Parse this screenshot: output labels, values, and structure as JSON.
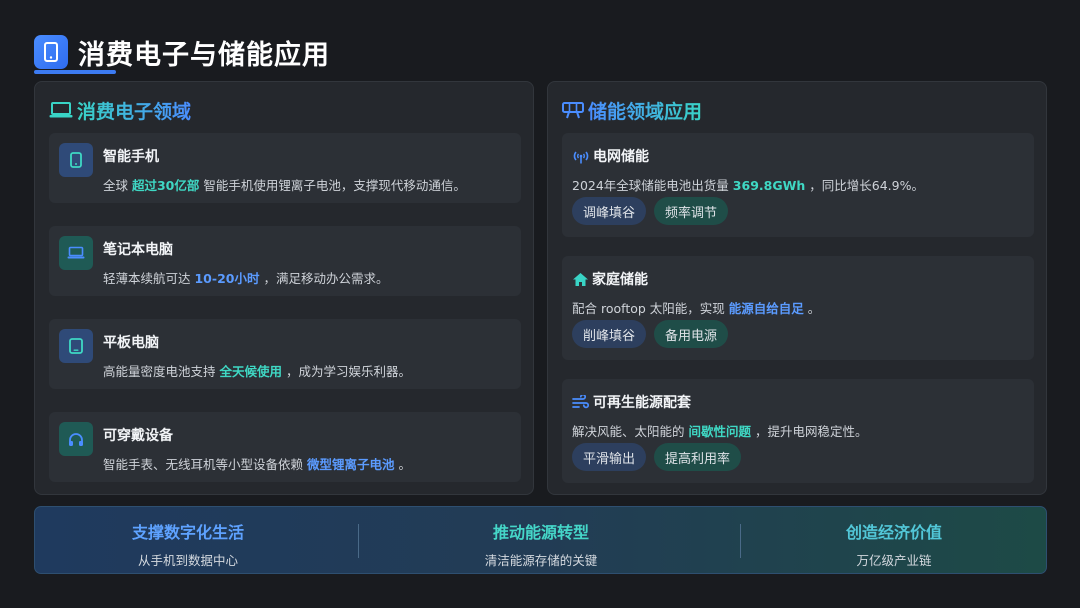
{
  "header": {
    "title": "消费电子与储能应用",
    "icon": "phone-icon"
  },
  "left_panel": {
    "title": "消费电子领域",
    "icon": "laptop-icon",
    "items": [
      {
        "name": "智能手机",
        "icon": "phone-icon",
        "pre": "全球 ",
        "highlight": "超过30亿部",
        "post": " 智能手机使用锂离子电池，支撑现代移动通信。"
      },
      {
        "name": "笔记本电脑",
        "icon": "laptop-icon",
        "pre": "轻薄本续航可达 ",
        "highlight": "10-20小时",
        "post": " ，满足移动办公需求。"
      },
      {
        "name": "平板电脑",
        "icon": "tablet-icon",
        "pre": "高能量密度电池支持 ",
        "highlight": "全天候使用",
        "post": " ，成为学习娱乐利器。"
      },
      {
        "name": "可穿戴设备",
        "icon": "headphones-icon",
        "pre": "智能手表、无线耳机等小型设备依赖 ",
        "highlight": "微型锂离子电池",
        "post": " 。"
      }
    ]
  },
  "right_panel": {
    "title": "储能领域应用",
    "icon": "grid-tower-icon",
    "items": [
      {
        "name": "电网储能",
        "icon": "broadcast-tower-icon",
        "pre": "2024年全球储能电池出货量 ",
        "highlight": "369.8GWh",
        "post": " ，同比增长64.9%。",
        "tags": [
          "调峰填谷",
          "频率调节"
        ]
      },
      {
        "name": "家庭储能",
        "icon": "home-icon",
        "pre": "配合 rooftop 太阳能，实现 ",
        "highlight": "能源自给自足",
        "post": " 。",
        "tags": [
          "削峰填谷",
          "备用电源"
        ]
      },
      {
        "name": "可再生能源配套",
        "icon": "wind-icon",
        "pre": "解决风能、太阳能的 ",
        "highlight": "间歇性问题",
        "post": " ，提升电网稳定性。",
        "tags": [
          "平滑输出",
          "提高利用率"
        ]
      }
    ]
  },
  "banner": [
    {
      "title": "支撑数字化生活",
      "subtitle": "从手机到数据中心"
    },
    {
      "title": "推动能源转型",
      "subtitle": "清洁能源存储的关键"
    },
    {
      "title": "创造经济价值",
      "subtitle": "万亿级产业链"
    }
  ],
  "colors": {
    "accent_blue": "#4a8dff",
    "accent_teal": "#39d4c6",
    "background": "#191b1f",
    "panel": "#25282d"
  }
}
